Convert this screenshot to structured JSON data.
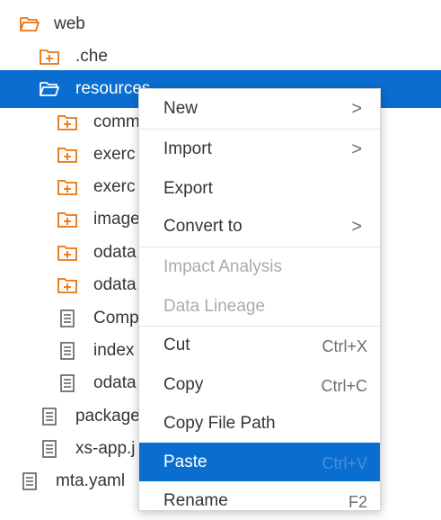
{
  "tree": {
    "items": [
      {
        "label": "web",
        "icon": "folder-open-icon"
      },
      {
        "label": ".che",
        "icon": "package-folder-icon"
      },
      {
        "label": "resources",
        "icon": "folder-open-icon"
      },
      {
        "label": "comm",
        "icon": "package-folder-icon"
      },
      {
        "label": "exerc",
        "icon": "package-folder-icon"
      },
      {
        "label": "exerc",
        "icon": "package-folder-icon"
      },
      {
        "label": "image",
        "icon": "package-folder-icon"
      },
      {
        "label": "odata",
        "icon": "package-folder-icon"
      },
      {
        "label": "odata",
        "icon": "package-folder-icon"
      },
      {
        "label": "Comp",
        "icon": "file-icon"
      },
      {
        "label": "index",
        "icon": "file-icon"
      },
      {
        "label": "odata",
        "icon": "file-icon"
      },
      {
        "label": "package",
        "icon": "file-icon"
      },
      {
        "label": "xs-app.j",
        "icon": "file-icon"
      },
      {
        "label": "mta.yaml",
        "icon": "file-icon"
      }
    ]
  },
  "context_menu": {
    "items": [
      {
        "label": "New",
        "submenu": true
      },
      {
        "label": "Import",
        "submenu": true
      },
      {
        "label": "Export"
      },
      {
        "label": "Convert to",
        "submenu": true
      },
      {
        "label": "Impact Analysis",
        "disabled": true
      },
      {
        "label": "Data Lineage",
        "disabled": true
      },
      {
        "label": "Cut",
        "shortcut": "Ctrl+X"
      },
      {
        "label": "Copy",
        "shortcut": "Ctrl+C"
      },
      {
        "label": "Copy File Path"
      },
      {
        "label": "Paste",
        "shortcut": "Ctrl+V",
        "highlighted": true
      },
      {
        "label": "Rename",
        "shortcut": "F2"
      }
    ],
    "submenu_glyph": ">"
  },
  "colors": {
    "selection": "#0a6ed1",
    "folder": "#e9730c"
  }
}
